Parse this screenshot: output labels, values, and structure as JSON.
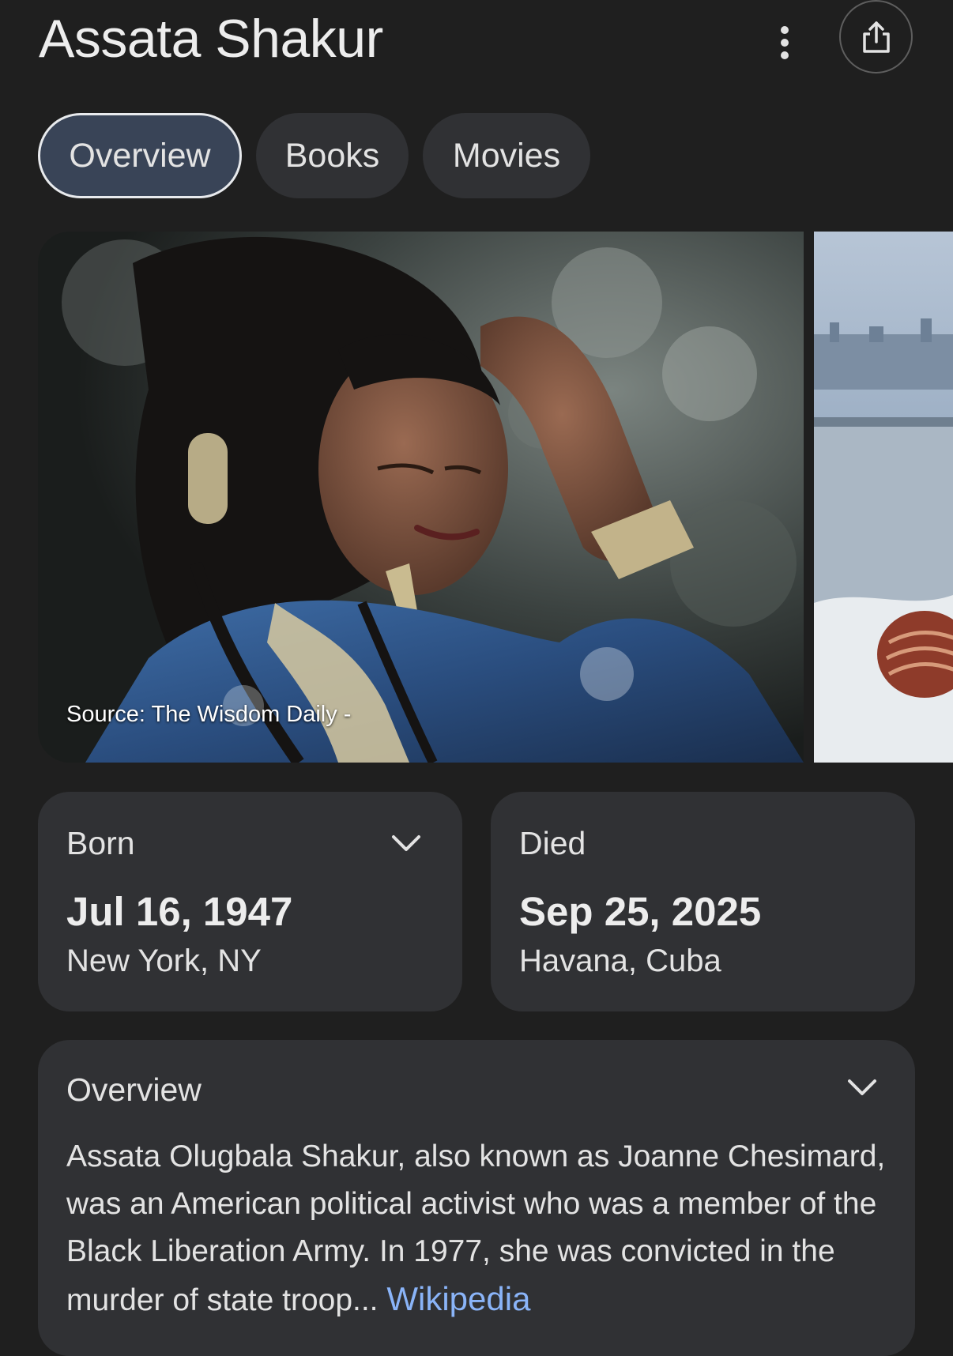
{
  "header": {
    "title": "Assata Shakur",
    "more_icon": "more-vert-icon",
    "share_icon": "share-icon"
  },
  "tabs": [
    {
      "label": "Overview",
      "active": true
    },
    {
      "label": "Books",
      "active": false
    },
    {
      "label": "Movies",
      "active": false
    }
  ],
  "images": {
    "main": {
      "caption": "Source: The Wisdom Daily -"
    }
  },
  "facts": {
    "born": {
      "label": "Born",
      "date": "Jul 16, 1947",
      "place": "New York, NY",
      "icon": "chevron-down-icon"
    },
    "died": {
      "label": "Died",
      "date": "Sep 25, 2025",
      "place": "Havana, Cuba"
    }
  },
  "overview": {
    "label": "Overview",
    "text": "Assata Olugbala Shakur, also known as Joanne Chesimard, was an American political activist who was a member of the Black Liberation Army. In 1977, she was convicted in the murder of state troop... ",
    "link_label": "Wikipedia",
    "icon": "chevron-down-icon"
  },
  "colors": {
    "background": "#1f1f1f",
    "card": "#303134",
    "active_tab": "#394457",
    "link": "#8ab4f8"
  }
}
